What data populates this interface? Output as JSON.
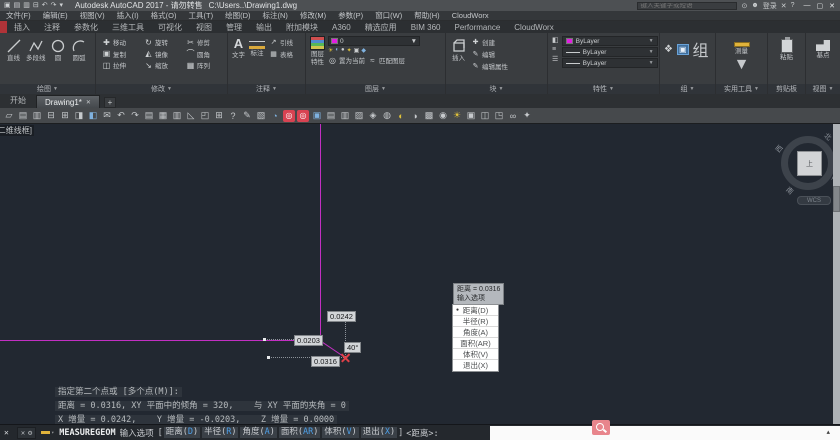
{
  "title_bar": {
    "qat_icons": [
      {
        "g": "▣",
        "n": "app-menu-icon"
      },
      {
        "g": "▤",
        "n": "open-icon"
      },
      {
        "g": "▥",
        "n": "save-icon"
      },
      {
        "g": "⊟",
        "n": "plot-icon"
      },
      {
        "g": "↶",
        "n": "undo-icon"
      },
      {
        "g": "↷",
        "n": "redo-icon"
      },
      {
        "g": "▾",
        "n": "workspace-dropdown-icon"
      }
    ],
    "title": "Autodesk AutoCAD 2017 - 请勿转售",
    "file_path": "C:\\Users..\\Drawing1.dwg",
    "search_placeholder": "键入关键字或短语",
    "search_icon": "⊙",
    "signin_icon": "☻",
    "signin_label": "登录",
    "exchange_icon": "✕",
    "help_icon": "?",
    "window": {
      "minimize": "—",
      "maximize": "▢",
      "close": "✕"
    }
  },
  "menu_bar": {
    "items": [
      "文件(F)",
      "编辑(E)",
      "视图(V)",
      "插入(I)",
      "格式(O)",
      "工具(T)",
      "绘图(D)",
      "标注(N)",
      "修改(M)",
      "参数(P)",
      "窗口(W)",
      "帮助(H)",
      "CloudWorx"
    ]
  },
  "ribbon": {
    "tabs": [
      {
        "label": "插入"
      },
      {
        "label": "注释"
      },
      {
        "label": "参数化"
      },
      {
        "label": "三维工具"
      },
      {
        "label": "可视化"
      },
      {
        "label": "视图"
      },
      {
        "label": "管理"
      },
      {
        "label": "输出"
      },
      {
        "label": "附加模块"
      },
      {
        "label": "A360"
      },
      {
        "label": "精选应用"
      },
      {
        "label": "BIM 360"
      },
      {
        "label": "Performance"
      },
      {
        "label": "CloudWorx"
      }
    ],
    "draw": {
      "title": "绘图",
      "items": [
        {
          "label": "直线"
        },
        {
          "label": "多段线"
        },
        {
          "label": "圆"
        },
        {
          "label": "圆弧"
        }
      ]
    },
    "modify": {
      "title": "修改",
      "items": [
        {
          "g": "✚",
          "label": "移动"
        },
        {
          "g": "↻",
          "label": "旋转"
        },
        {
          "g": "✂",
          "label": "修剪"
        },
        {
          "g": "▣",
          "label": "复制"
        },
        {
          "g": "◭",
          "label": "镜像"
        },
        {
          "g": "⌒",
          "label": "圆角"
        },
        {
          "g": "◫",
          "label": "拉伸"
        },
        {
          "g": "↘",
          "label": "缩放"
        },
        {
          "g": "▦",
          "label": "阵列"
        }
      ]
    },
    "annotation": {
      "title": "注释",
      "text_label": "文字",
      "dim_label": "标注",
      "small_items": [
        {
          "g": "↗",
          "label": "引线"
        },
        {
          "g": "▦",
          "label": "表格"
        }
      ]
    },
    "layers": {
      "title": "图层",
      "big_label_1": "图层",
      "big_label_2": "特性",
      "dropdown_value": "0",
      "buttons": [
        {
          "g": "◎",
          "label": "置为当前"
        },
        {
          "g": "≈",
          "label": "匹配图层"
        }
      ],
      "state_icons": [
        {
          "g": "☀",
          "c": "#e0c23a"
        },
        {
          "g": "◐",
          "c": "#7fb2e0"
        },
        {
          "g": "●",
          "c": "#c9ccce"
        },
        {
          "g": "✦",
          "c": "#e0c23a"
        },
        {
          "g": "▣",
          "c": "#c9ccce"
        },
        {
          "g": "◆",
          "c": "#7fb2e0"
        }
      ]
    },
    "block": {
      "title": "块",
      "big_label": "插入",
      "items": [
        {
          "g": "✚",
          "label": "创建"
        },
        {
          "g": "✎",
          "label": "编辑"
        },
        {
          "g": "✎",
          "label": "编辑属性"
        }
      ]
    },
    "properties": {
      "title": "特性",
      "left_icons": [
        {
          "g": "◧"
        },
        {
          "g": "≡"
        },
        {
          "g": "☰"
        }
      ],
      "color_value": "ByLayer",
      "lineweight_value": "ByLayer",
      "linetype_value": "ByLayer",
      "color_swatch": "#e21ee2"
    },
    "group": {
      "title": "组",
      "label": "组"
    },
    "utilities": {
      "title": "实用工具",
      "measure_label": "测量"
    },
    "clipboard": {
      "title": "剪贴板",
      "paste_label": "粘贴"
    },
    "view": {
      "title": "视图",
      "base_label": "基点"
    }
  },
  "file_tabs": {
    "start_label": "开始",
    "active_tab": "Drawing1*",
    "close_icon": "✕",
    "add_icon": "+"
  },
  "classic_toolbar": {
    "icons": [
      {
        "g": "▱",
        "n": "new-icon"
      },
      {
        "g": "▤",
        "n": "open-icon"
      },
      {
        "g": "▥",
        "n": "save-icon"
      },
      {
        "g": "⊟",
        "n": "print-icon"
      },
      {
        "g": "⊞",
        "n": "preview-icon"
      },
      {
        "g": "◨",
        "n": "plot-icon"
      },
      {
        "g": "◧",
        "n": "publish-icon",
        "c": "#7fb2e0"
      },
      {
        "g": "✉",
        "n": "etransmit-icon"
      },
      {
        "g": "↶",
        "n": "undo-icon"
      },
      {
        "g": "↷",
        "n": "redo-icon"
      },
      {
        "g": "▤",
        "n": "layer-properties-icon"
      },
      {
        "g": "▦",
        "n": "layer-states-icon"
      },
      {
        "g": "▥",
        "n": "layer-walk-icon"
      },
      {
        "g": "◺",
        "n": "measure-icon"
      },
      {
        "g": "◰",
        "n": "blocks-icon"
      },
      {
        "g": "⊞",
        "n": "quickcalc-icon"
      },
      {
        "g": "?",
        "n": "help-icon"
      },
      {
        "g": "✎",
        "n": "markup-icon"
      },
      {
        "g": "▧",
        "n": "publish-set-icon"
      },
      {
        "g": "◔",
        "n": "sync-icon",
        "c": "#7fb2e0"
      },
      {
        "g": "◎",
        "n": "cloudworx-target-icon",
        "red": true
      },
      {
        "g": "◎",
        "n": "cloudworx-fit-icon",
        "red": true
      },
      {
        "g": "▣",
        "n": "truview-icon",
        "c": "#7fb2e0"
      },
      {
        "g": "▤",
        "n": "import-icon"
      },
      {
        "g": "▥",
        "n": "export-icon"
      },
      {
        "g": "▨",
        "n": "sheetset-icon"
      },
      {
        "g": "◈",
        "n": "model-icon"
      },
      {
        "g": "◍",
        "n": "regen-icon"
      },
      {
        "g": "◐",
        "n": "render-icon",
        "c": "#e0c23a"
      },
      {
        "g": "◑",
        "n": "shade-icon"
      },
      {
        "g": "▩",
        "n": "materials-icon"
      },
      {
        "g": "◉",
        "n": "camera-icon"
      },
      {
        "g": "☀",
        "n": "light-icon",
        "c": "#e0c23a"
      },
      {
        "g": "▣",
        "n": "view-icon"
      },
      {
        "g": "◫",
        "n": "section-icon"
      },
      {
        "g": "◳",
        "n": "pointcloud-icon"
      },
      {
        "g": "∞",
        "n": "link-icon"
      },
      {
        "g": "✦",
        "n": "effects-icon"
      }
    ]
  },
  "drawing_area": {
    "viewport_label": "[-][俯视][二维线框]",
    "dim_dx": "0.0242",
    "dim_dy": "0.0203",
    "dim_angle": "40°",
    "dim_distance": "0.0316",
    "tooltip_line1": "距离 = 0.0316",
    "tooltip_line2": "输入选项",
    "context_menu": {
      "bullet": "●",
      "items": [
        {
          "label": "距离(D)",
          "selected": true
        },
        {
          "label": "半径(R)"
        },
        {
          "label": "角度(A)"
        },
        {
          "label": "面积(AR)"
        },
        {
          "label": "体积(V)"
        },
        {
          "label": "退出(X)"
        }
      ]
    },
    "command_history": [
      "指定第二个点或 [多个点(M)]:",
      "距离 = 0.0316, XY 平面中的倾角 = 320,    与 XY 平面的夹角 = 0",
      "X 增量 = 0.0242,    Y 增量 = -0.0203,    Z 增量 = 0.0000"
    ],
    "viewcube": {
      "top": "上",
      "north": "北",
      "south": "南",
      "east": "东",
      "west": "西",
      "pill": "WCS"
    }
  },
  "command_line": {
    "close_icon": "✕",
    "mini_close_icon": "✕",
    "tool_icon": "⚙",
    "command": "MEASUREGEOM",
    "prompt": "输入选项",
    "bracket_open": "[",
    "bracket_close": "]",
    "options": [
      {
        "pre": "距离(",
        "key": "D",
        "post": ")"
      },
      {
        "pre": "半径(",
        "key": "R",
        "post": ")"
      },
      {
        "pre": "角度(",
        "key": "A",
        "post": ")"
      },
      {
        "pre": "面积(",
        "key": "AR",
        "post": ")"
      },
      {
        "pre": "体积(",
        "key": "V",
        "post": ")"
      },
      {
        "pre": "退出(",
        "key": "X",
        "post": ")"
      }
    ],
    "default_hint": "<距离>:",
    "overlay_arrow": "▴"
  },
  "colors": {
    "crosshair_magenta": "#c22fc2",
    "marker_red": "#e04048",
    "accent_blue": "#4d9fe8",
    "layer_swatch_magenta": "#e21ee2",
    "cloudworx_red": "#d84352"
  }
}
